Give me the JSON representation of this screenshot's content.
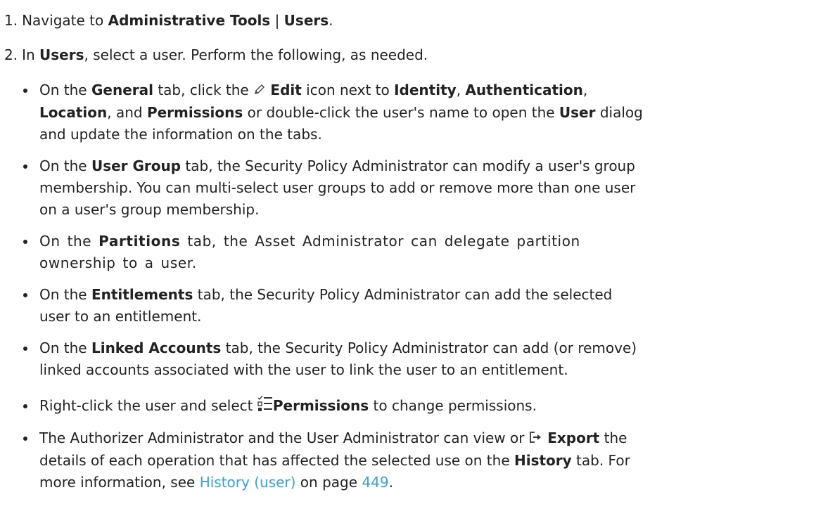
{
  "steps": [
    {
      "num": "1.",
      "t1": "Navigate to ",
      "b1": "Administrative Tools",
      "t2": " | ",
      "b2": "Users",
      "t3": "."
    },
    {
      "num": "2.",
      "t1": "In ",
      "b1": "Users",
      "t2": ", select a user. Perform the following, as needed."
    }
  ],
  "bullets": {
    "general": {
      "l1_a": "On the ",
      "l1_b": "General",
      "l1_c": " tab, click the ",
      "l1_edit": "Edit",
      "l1_d": " icon next to ",
      "l1_identity": "Identity",
      "l1_e": ", ",
      "l1_auth": "Authentication",
      "l1_f": ",",
      "l2_location": "Location",
      "l2_a": ", and ",
      "l2_permissions": "Permissions",
      "l2_b": " or double-click the user's name to open the ",
      "l2_user": "User",
      "l2_c": " dialog",
      "l3": "and update the information on the tabs."
    },
    "user_group": {
      "l1_a": "On the ",
      "l1_b": "User Group",
      "l1_c": " tab, the Security Policy Administrator can modify a user's group",
      "l2": "membership. You can multi-select user groups to add or remove more than one user",
      "l3": "on a user's group membership."
    },
    "partitions": {
      "l1_a": "On the ",
      "l1_b": "Partitions",
      "l1_c": " tab, the Asset Administrator can delegate partition",
      "l2": "ownership to a user."
    },
    "entitlements": {
      "l1_a": "On the ",
      "l1_b": "Entitlements",
      "l1_c": " tab, the Security Policy Administrator can add the selected",
      "l2": "user to an entitlement."
    },
    "linked": {
      "l1_a": "On the ",
      "l1_b": "Linked Accounts",
      "l1_c": " tab, the Security Policy Administrator can add (or remove)",
      "l2": "linked accounts associated with the user to link the user to an entitlement."
    },
    "right_click": {
      "a": "Right-click the user and select ",
      "b": "Permissions",
      "c": " to change permissions."
    },
    "history": {
      "l1_a": "The Authorizer Administrator and the User Administrator can view or ",
      "l1_export": "Export",
      "l1_b": " the",
      "l2_a": "details of each operation that has affected the selected use on the ",
      "l2_history": "History",
      "l2_b": " tab. For",
      "l3_a": "more information, see ",
      "l3_link": "History (user)",
      "l3_b": " on page ",
      "l3_page": "449",
      "l3_c": "."
    }
  },
  "icons": {
    "edit": "pencil-icon",
    "permissions": "permissions-checklist-icon",
    "export": "export-icon"
  },
  "colors": {
    "text": "#222222",
    "link": "#3aa1d6"
  }
}
